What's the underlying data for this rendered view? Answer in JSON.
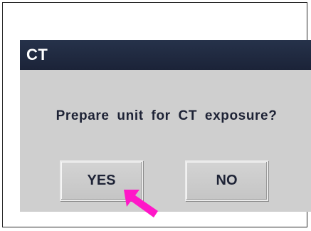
{
  "dialog": {
    "title": "CT",
    "message": "Prepare unit for CT exposure?",
    "buttons": {
      "yes": "YES",
      "no": "NO"
    }
  },
  "colors": {
    "titlebar": "#1f2940",
    "dialog_bg": "#cfcfcf",
    "text": "#1d2235",
    "cursor_arrow": "#ff17c8"
  },
  "icons": {
    "pointer": "arrow-pointer-icon"
  }
}
